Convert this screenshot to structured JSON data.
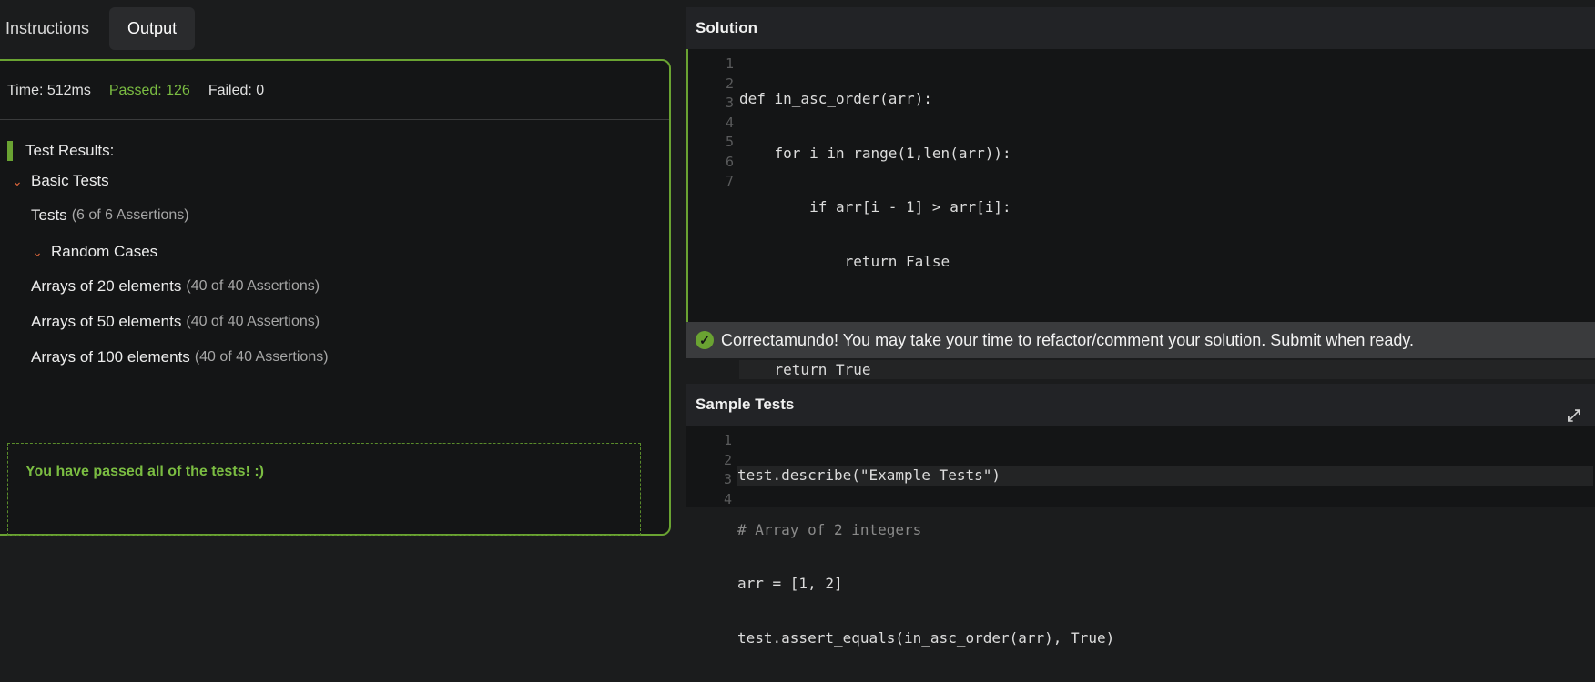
{
  "tabs": [
    {
      "label": "Instructions",
      "active": false
    },
    {
      "label": "Output",
      "active": true
    }
  ],
  "stats": {
    "time": "Time: 512ms",
    "passed": "Passed: 126",
    "failed": "Failed: 0"
  },
  "results_heading": "Test Results:",
  "tree": [
    {
      "label": "Basic Tests",
      "meta": "",
      "state": "expanded"
    },
    {
      "label": "Tests",
      "meta": "(6 of 6 Assertions)",
      "state": "collapsed"
    },
    {
      "label": "Random Cases",
      "meta": "",
      "state": "expanded"
    },
    {
      "label": "Arrays of 20 elements",
      "meta": "(40 of 40 Assertions)",
      "state": "collapsed"
    },
    {
      "label": "Arrays of 50 elements",
      "meta": "(40 of 40 Assertions)",
      "state": "collapsed"
    },
    {
      "label": "Arrays of 100 elements",
      "meta": "(40 of 40 Assertions)",
      "state": "collapsed"
    }
  ],
  "pass_message": "You have passed all of the tests! :)",
  "solution": {
    "title": "Solution",
    "line_numbers": [
      "1",
      "2",
      "3",
      "4",
      "5",
      "6",
      "7"
    ],
    "code": [
      "def in_asc_order(arr):",
      "    for i in range(1,len(arr)):",
      "        if arr[i - 1] > arr[i]:",
      "            return False",
      "",
      "    return True",
      ""
    ]
  },
  "success_message": "Correctamundo! You may take your time to refactor/comment your solution. Submit when ready.",
  "sample_tests": {
    "title": "Sample Tests",
    "line_numbers": [
      "1",
      "2",
      "3",
      "4"
    ],
    "code": [
      "test.describe(\"Example Tests\")",
      "# Array of 2 integers",
      "arr = [1, 2]",
      "test.assert_equals(in_asc_order(arr), True)"
    ]
  },
  "colors": {
    "accent": "#6aa332",
    "pass_text": "#7bbd42",
    "error_chevron": "#d9653b"
  }
}
